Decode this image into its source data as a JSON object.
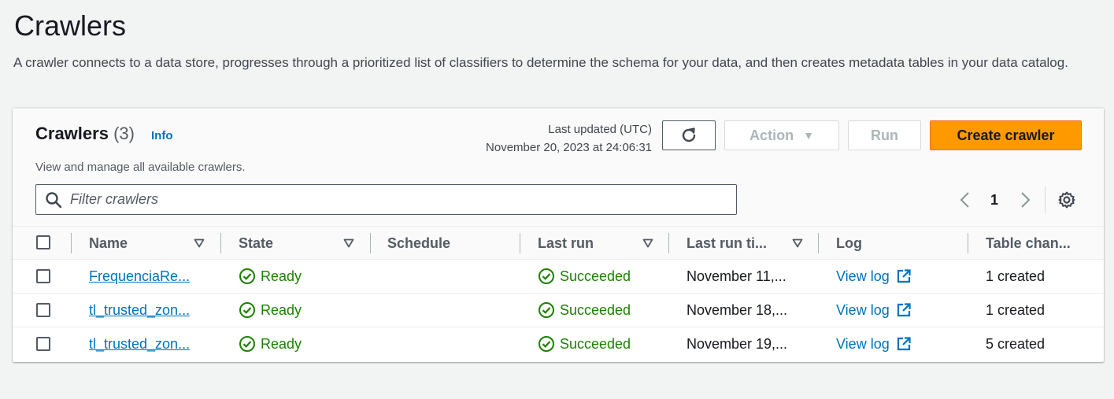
{
  "page": {
    "title": "Crawlers",
    "description": "A crawler connects to a data store, progresses through a prioritized list of classifiers to determine the schema for your data, and then creates metadata tables in your data catalog."
  },
  "panel": {
    "title": "Crawlers",
    "count": "(3)",
    "info_label": "Info",
    "description": "View and manage all available crawlers.",
    "last_updated_label": "Last updated (UTC)",
    "last_updated_value": "November 20, 2023 at 24:06:31",
    "action_label": "Action",
    "run_label": "Run",
    "create_label": "Create crawler",
    "search_placeholder": "Filter crawlers",
    "page_number": "1"
  },
  "table": {
    "columns": [
      "Name",
      "State",
      "Schedule",
      "Last run",
      "Last run ti...",
      "Log",
      "Table chan..."
    ],
    "rows": [
      {
        "name": "FrequenciaRe...",
        "state": "Ready",
        "schedule": "",
        "last_run": "Succeeded",
        "last_run_time": "November 11,...",
        "log": "View log",
        "table_changes": "1 created"
      },
      {
        "name": "tl_trusted_zon...",
        "state": "Ready",
        "schedule": "",
        "last_run": "Succeeded",
        "last_run_time": "November 18,...",
        "log": "View log",
        "table_changes": "1 created"
      },
      {
        "name": "tl_trusted_zon...",
        "state": "Ready",
        "schedule": "",
        "last_run": "Succeeded",
        "last_run_time": "November 19,...",
        "log": "View log",
        "table_changes": "5 created"
      }
    ]
  },
  "colors": {
    "primary_button": "#ff9900",
    "link": "#0073bb",
    "success": "#1d8102"
  },
  "icons": {
    "refresh": "refresh-icon",
    "search": "search-icon",
    "settings": "gear-icon",
    "status": "check-circle-icon",
    "external": "external-link-icon"
  }
}
